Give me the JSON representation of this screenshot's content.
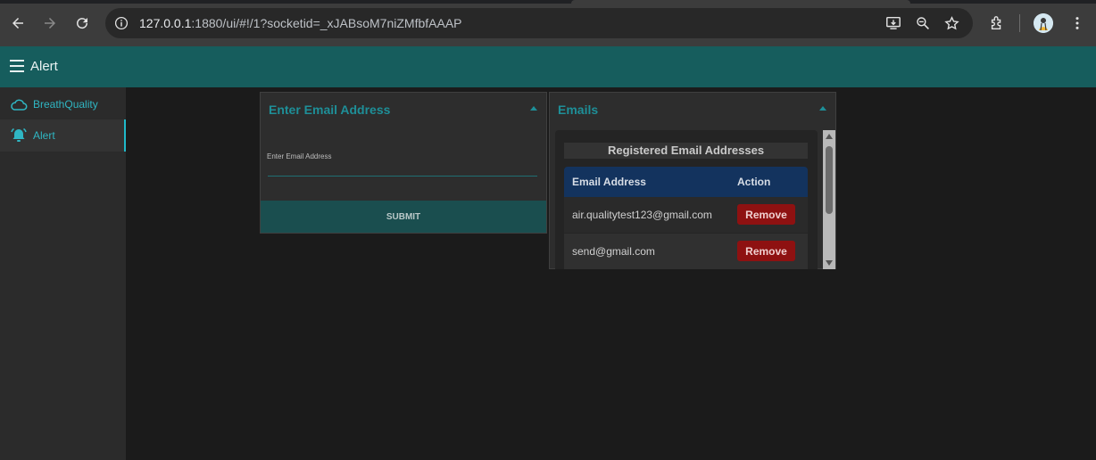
{
  "browser": {
    "url_host": "127.0.0.1",
    "url_rest": ":1880/ui/#!/1?socketid=_xJABsoM7niZMfbfAAAP",
    "icons": [
      "back-arrow-icon",
      "forward-arrow-icon",
      "reload-icon",
      "site-info-icon",
      "install-app-icon",
      "zoom-icon",
      "bookmark-star-icon",
      "extensions-icon",
      "profile-avatar",
      "more-menu-icon"
    ]
  },
  "header": {
    "title": "Alert",
    "menu_icon": "hamburger-menu-icon",
    "bg_color": "#165d5d"
  },
  "sidebar": {
    "items": [
      {
        "label": "BreathQuality",
        "icon": "cloud-icon",
        "active": false
      },
      {
        "label": "Alert",
        "icon": "bell-alarm-icon",
        "active": true
      }
    ],
    "accent_color": "#2fb6c3"
  },
  "email_form": {
    "title": "Enter Email Address",
    "field_label": "Enter Email Address",
    "field_value": "",
    "submit_label": "SUBMIT"
  },
  "emails_card": {
    "title": "Emails",
    "table_title": "Registered Email Addresses",
    "columns": [
      "Email Address",
      "Action"
    ],
    "rows": [
      {
        "email": "air.qualitytest123@gmail.com",
        "action": "Remove"
      },
      {
        "email": "send@gmail.com",
        "action": "Remove"
      }
    ],
    "remove_color": "#8e1111",
    "header_color": "#13335e"
  }
}
